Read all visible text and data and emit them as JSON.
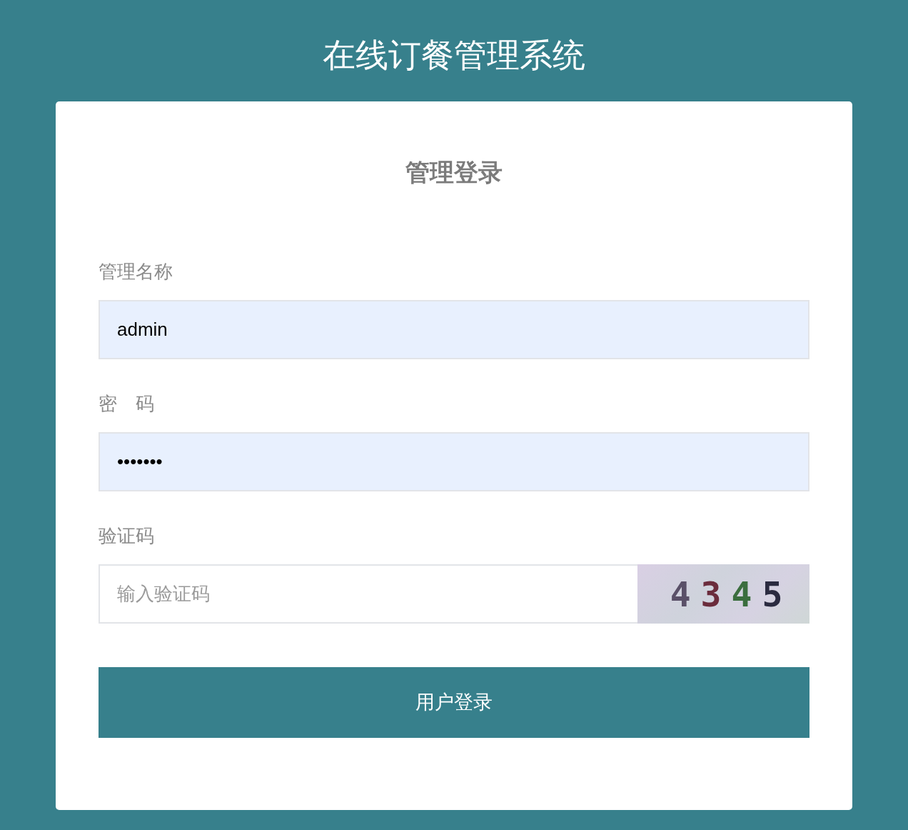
{
  "title": "在线订餐管理系统",
  "login_card": {
    "heading": "管理登录",
    "fields": [
      {
        "kind": "text",
        "label": "管理名称",
        "value": "admin"
      },
      {
        "kind": "password",
        "label": "密　码",
        "value": "•••••••"
      },
      {
        "kind": "captcha",
        "label": "验证码",
        "placeholder": "输入验证码",
        "captcha": {
          "digits": [
            {
              "text": "4",
              "color": "#5a5068"
            },
            {
              "text": "3",
              "color": "#6b2c3c"
            },
            {
              "text": "4",
              "color": "#3b6e3e"
            },
            {
              "text": "5",
              "color": "#2b2b40"
            }
          ]
        }
      }
    ],
    "button": "用户登录"
  }
}
